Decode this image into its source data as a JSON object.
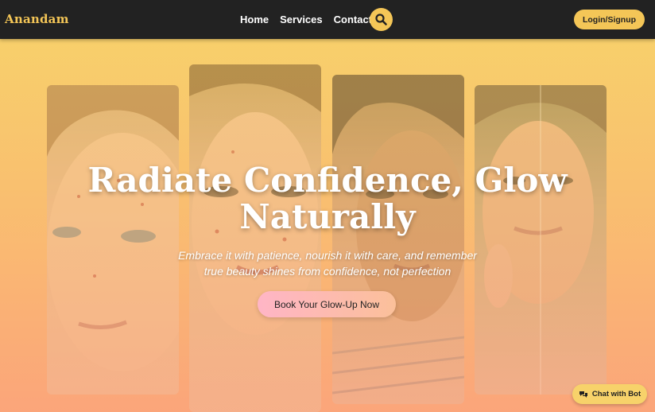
{
  "brand": {
    "name": "Anandam"
  },
  "nav": {
    "links": [
      {
        "label": "Home"
      },
      {
        "label": "Services"
      },
      {
        "label": "Contact"
      }
    ],
    "search_icon": "search-icon",
    "login_label": "Login/Signup"
  },
  "hero": {
    "title_line1": "Radiate Confidence, Glow",
    "title_line2": "Naturally",
    "subtitle_line1": "Embrace it with patience, nourish it with care, and remember",
    "subtitle_line2": "true beauty shines from confidence, not perfection",
    "cta_label": "Book Your Glow-Up Now",
    "images": [
      {
        "description": "young woman face with acne"
      },
      {
        "description": "woman face with acne spots"
      },
      {
        "description": "woman with freckled skin"
      },
      {
        "description": "man with acne, split face"
      }
    ]
  },
  "chat": {
    "label": "Chat with Bot",
    "icon": "chat-icon"
  },
  "colors": {
    "accent": "#f4c657",
    "navbar": "#222222",
    "gradient_top": "#f7d26a",
    "gradient_bottom": "#fba57a"
  }
}
